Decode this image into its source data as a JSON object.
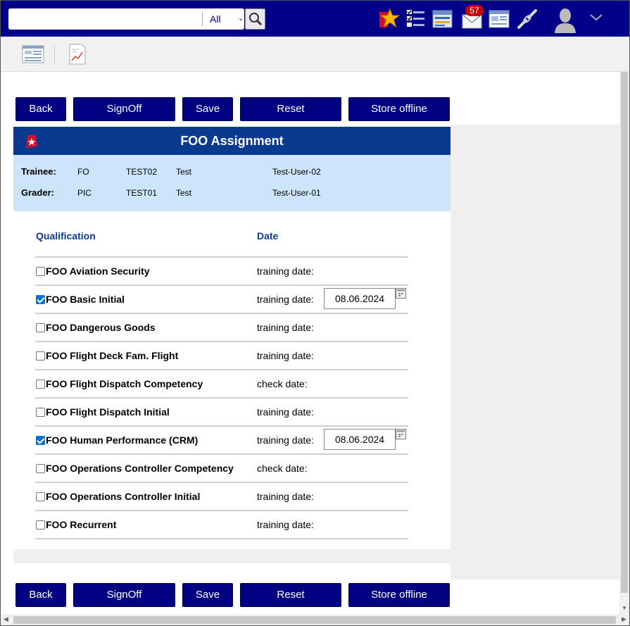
{
  "search": {
    "placeholder": "",
    "scope": "All"
  },
  "topbar": {
    "icons": [
      "favorites-star-icon",
      "task-list-icon",
      "news-icon",
      "mail-icon",
      "report-icon",
      "link-icon",
      "user-avatar-icon",
      "chevron-down-icon"
    ],
    "mail_count": "57"
  },
  "toolbar2": {
    "icons": [
      "list-view-icon",
      "document-chart-icon"
    ]
  },
  "actions": {
    "back": "Back",
    "signoff": "SignOff",
    "save": "Save",
    "reset": "Reset",
    "store_offline": "Store offline"
  },
  "panel": {
    "title": "FOO Assignment",
    "trainee": {
      "label": "Trainee:",
      "role": "FO",
      "code": "TEST02",
      "name": "Test",
      "user": "Test-User-02"
    },
    "grader": {
      "label": "Grader:",
      "role": "PIC",
      "code": "TEST01",
      "name": "Test",
      "user": "Test-User-01"
    },
    "col_qualification": "Qualification",
    "col_date": "Date",
    "rows": [
      {
        "name": "FOO Aviation Security",
        "date_label": "training date:",
        "checked": false,
        "date": ""
      },
      {
        "name": "FOO Basic Initial",
        "date_label": "training date:",
        "checked": true,
        "date": "08.06.2024"
      },
      {
        "name": "FOO Dangerous Goods",
        "date_label": "training date:",
        "checked": false,
        "date": ""
      },
      {
        "name": "FOO Flight Deck Fam. Flight",
        "date_label": "training date:",
        "checked": false,
        "date": ""
      },
      {
        "name": "FOO Flight Dispatch Competency",
        "date_label": "check date:",
        "checked": false,
        "date": ""
      },
      {
        "name": "FOO Flight Dispatch Initial",
        "date_label": "training date:",
        "checked": false,
        "date": ""
      },
      {
        "name": "FOO Human Performance (CRM)",
        "date_label": "training date:",
        "checked": true,
        "date": "08.06.2024"
      },
      {
        "name": "FOO Operations Controller Competency",
        "date_label": "check date:",
        "checked": false,
        "date": ""
      },
      {
        "name": "FOO Operations Controller Initial",
        "date_label": "training date:",
        "checked": false,
        "date": ""
      },
      {
        "name": "FOO Recurrent",
        "date_label": "training date:",
        "checked": false,
        "date": ""
      }
    ]
  }
}
